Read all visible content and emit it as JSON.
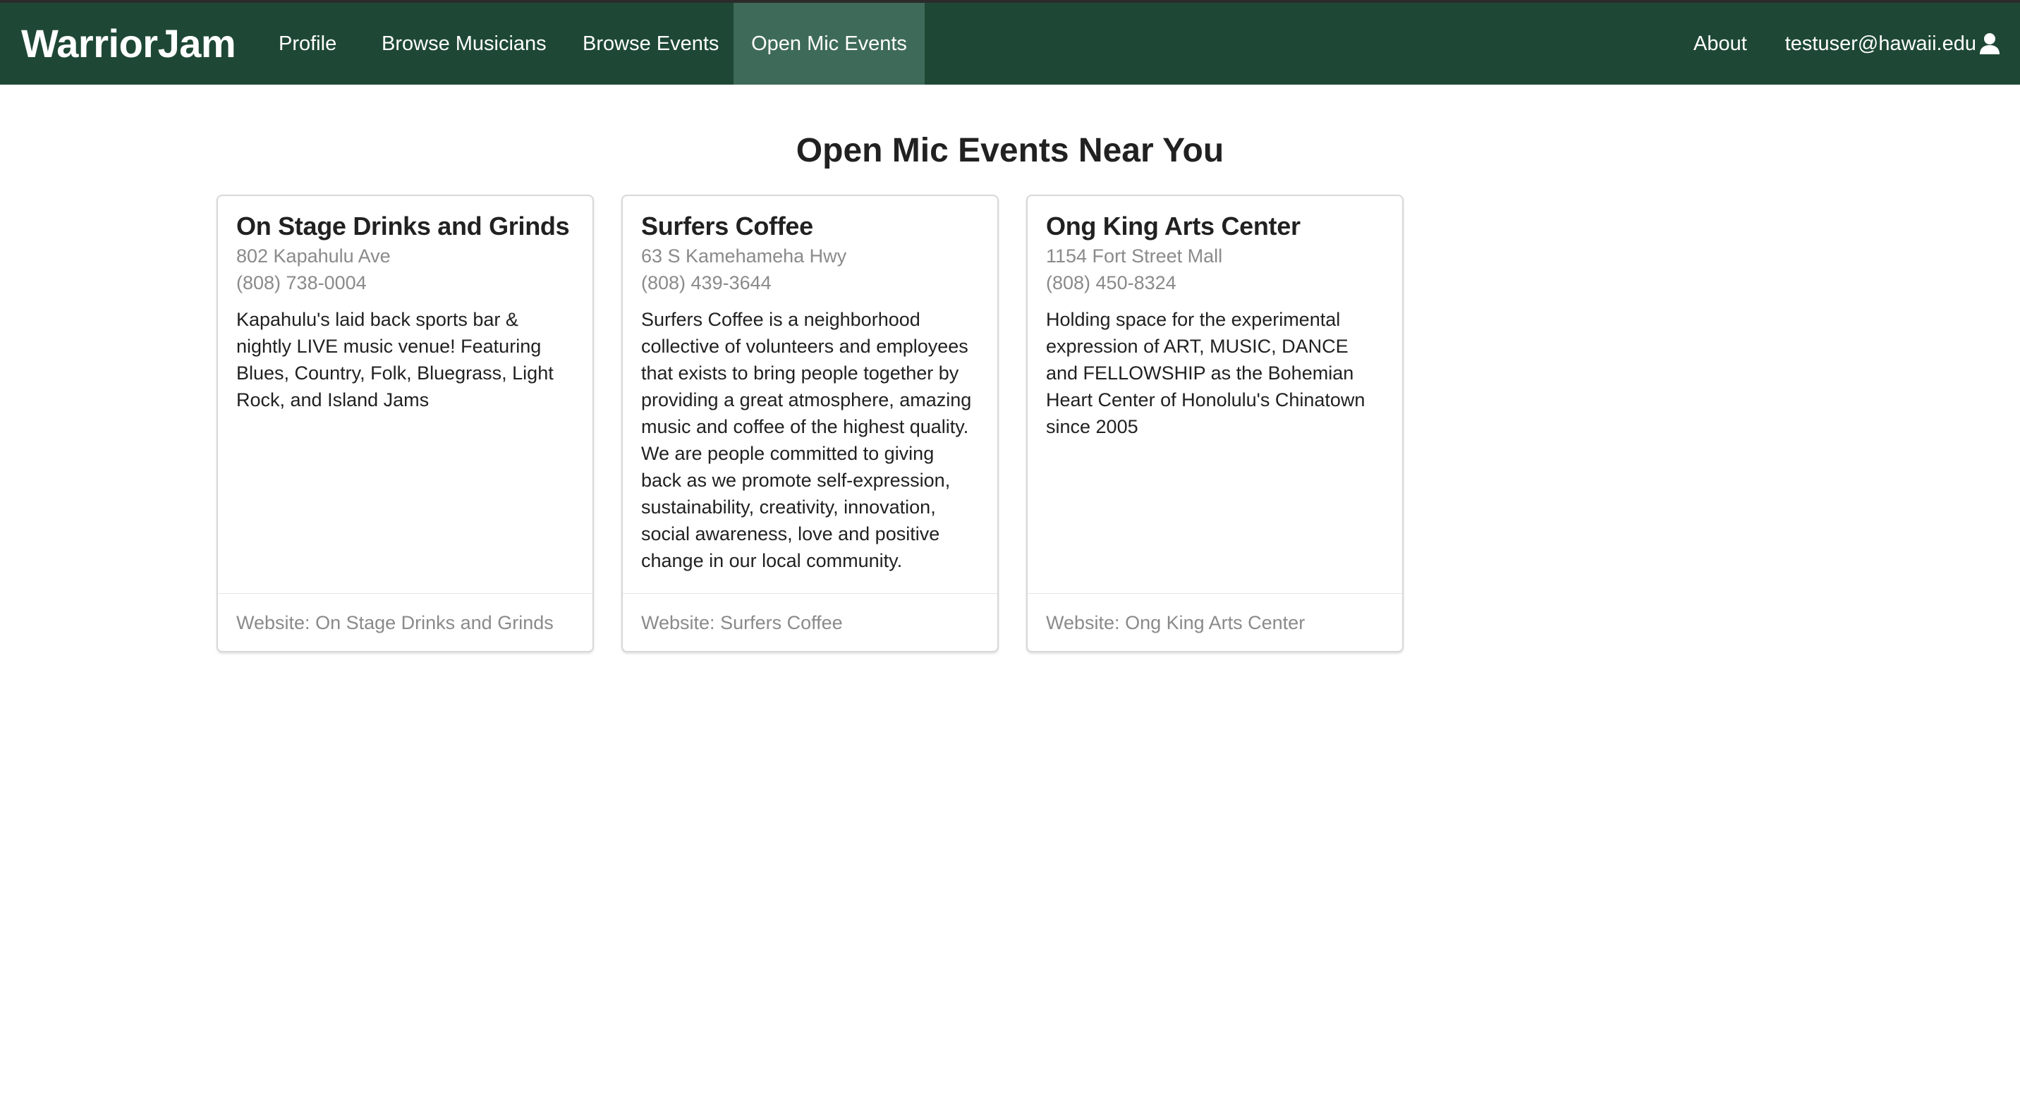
{
  "navbar": {
    "brand": "WarriorJam",
    "links": [
      {
        "label": "Profile"
      },
      {
        "label": "Browse Musicians"
      },
      {
        "label": "Browse Events"
      },
      {
        "label": "Open Mic Events",
        "active": true
      }
    ],
    "about_label": "About",
    "user_email": "testuser@hawaii.edu",
    "user_icon": "user-icon",
    "background_color": "#1e4835",
    "active_color": "#3e6a59"
  },
  "main": {
    "title": "Open Mic Events Near You",
    "cards": [
      {
        "name": "On Stage Drinks and Grinds",
        "address": "802 Kapahulu Ave",
        "phone": "(808) 738-0004",
        "description": "Kapahulu's laid back sports bar & nightly LIVE music venue! Featuring Blues, Country, Folk, Bluegrass, Light Rock, and Island Jams",
        "website_prefix": "Website:",
        "website_label": "On Stage Drinks and Grinds"
      },
      {
        "name": "Surfers Coffee",
        "address": "63 S Kamehameha Hwy",
        "phone": "(808) 439-3644",
        "description": "Surfers Coffee is a neighborhood collective of volunteers and employees that exists to bring people together by providing a great atmosphere, amazing music and coffee of the highest quality. We are people committed to giving back as we promote self-expression, sustainability, creativity, innovation, social awareness, love and positive change in our local community.",
        "website_prefix": "Website:",
        "website_label": "Surfers Coffee"
      },
      {
        "name": "Ong King Arts Center",
        "address": "1154 Fort Street Mall",
        "phone": "(808) 450-8324",
        "description": "Holding space for the experimental expression of ART, MUSIC, DANCE and FELLOWSHIP as the Bohemian Heart Center of Honolulu's Chinatown since 2005",
        "website_prefix": "Website:",
        "website_label": "Ong King Arts Center"
      }
    ]
  }
}
